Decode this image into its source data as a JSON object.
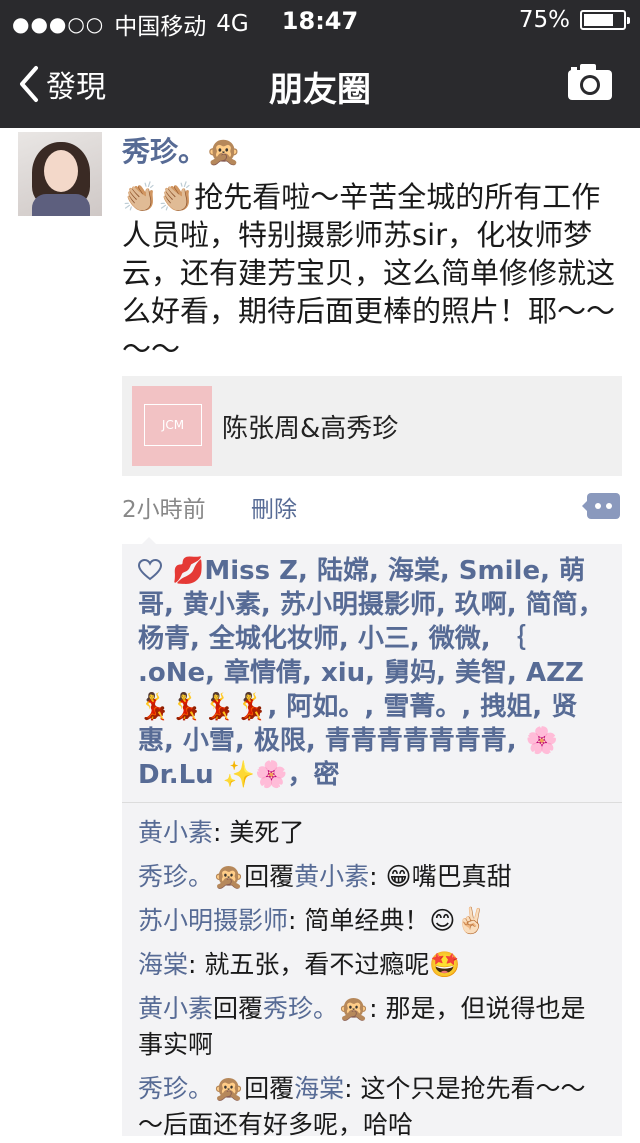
{
  "status_bar": {
    "carrier": "中国移动",
    "network": "4G",
    "time": "18:47",
    "battery": "75%",
    "battery_level": 0.75
  },
  "nav": {
    "back_label": "發現",
    "title": "朋友圈",
    "camera_icon": "camera-icon"
  },
  "post": {
    "author": "秀珍。🙊",
    "text": "👏🏼👏🏼抢先看啦～辛苦全城的所有工作人员啦，特别摄影师苏sir，化妆师梦云，还有建芳宝贝，这么简单修修就这么好看，期待后面更棒的照片！耶～～～～",
    "link": {
      "title": "陈张周&高秀珍",
      "thumb_text": "JCM"
    },
    "time_ago": "2小時前",
    "delete_label": "刪除",
    "likes": "💋Miss Z, 陆嫦, 海棠, Smile, 萌哥, 黄小素, 苏小明摄影师, 玖啊, 简简，杨青, 全城化妆师, 小三, 微微, ｛ .oNe, 章情倩, xiu, 舅妈, 美智, AZZ 💃💃💃💃, 阿如。, 雪菁。, 拽姐, 贤惠, 小雪, 极限, 青青青青青青青, 🌸 Dr.Lu ✨🌸，密",
    "comments": [
      {
        "user": "黄小素",
        "reply_to": "",
        "sep": ": ",
        "text": "美死了"
      },
      {
        "user": "秀珍。🙊",
        "reply_to": "黄小素",
        "sep": ": ",
        "text": "😁嘴巴真甜"
      },
      {
        "user": "苏小明摄影师",
        "reply_to": "",
        "sep": ": ",
        "text": "简单经典！😊✌🏻"
      },
      {
        "user": "海棠",
        "reply_to": "",
        "sep": ": ",
        "text": "就五张，看不过瘾呢🤩"
      },
      {
        "user": "黄小素",
        "reply_to": "秀珍。🙊",
        "sep": ": ",
        "text": "那是，但说得也是事实啊"
      },
      {
        "user": "秀珍。🙊",
        "reply_to": "海棠",
        "sep": ": ",
        "text": "这个只是抢先看～～～后面还有好多呢，哈哈"
      }
    ],
    "reply_word": "回覆"
  },
  "colors": {
    "nav_bg": "#2a2a2d",
    "link_blue": "#576b95",
    "panel_bg": "#f3f3f5"
  }
}
